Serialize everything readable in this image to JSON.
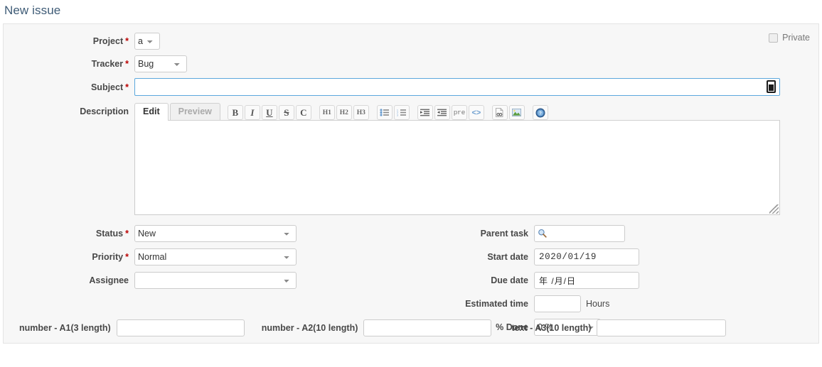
{
  "page": {
    "title": "New issue"
  },
  "privacy": {
    "checkbox_name": "private-checkbox",
    "label": "Private",
    "checked": false
  },
  "fields": {
    "project": {
      "label": "Project",
      "required": "*",
      "value": "a"
    },
    "tracker": {
      "label": "Tracker",
      "required": "*",
      "value": "Bug"
    },
    "subject": {
      "label": "Subject",
      "required": "*",
      "value": "",
      "placeholder": ""
    },
    "description": {
      "label": "Description",
      "value": "",
      "placeholder": ""
    },
    "status": {
      "label": "Status",
      "required": "*",
      "value": "New"
    },
    "priority": {
      "label": "Priority",
      "required": "*",
      "value": "Normal"
    },
    "assignee": {
      "label": "Assignee",
      "value": ""
    },
    "parent_task": {
      "label": "Parent task",
      "value": "",
      "icon": "magnifier-icon"
    },
    "start_date": {
      "label": "Start date",
      "value": "2020/01/19"
    },
    "due_date": {
      "label": "Due date",
      "value": "年 /月/日"
    },
    "estimated_time": {
      "label": "Estimated time",
      "value": "",
      "units": "Hours"
    },
    "done_ratio": {
      "label": "% Done",
      "value": "0 %"
    }
  },
  "editor": {
    "tabs": [
      {
        "label": "Edit",
        "active": true
      },
      {
        "label": "Preview",
        "active": false
      }
    ],
    "toolbar": [
      {
        "name": "bold-icon",
        "glyph": "B",
        "style": "serif"
      },
      {
        "name": "italic-icon",
        "glyph": "I",
        "style": "serif-italic"
      },
      {
        "name": "underline-icon",
        "glyph": "U",
        "style": "serif-underline"
      },
      {
        "name": "strikethrough-icon",
        "glyph": "S",
        "style": "serif-strike"
      },
      {
        "name": "code-inline-icon",
        "glyph": "C",
        "style": "serif"
      },
      {
        "name": "heading-1-icon",
        "glyph": "H1",
        "style": "heading"
      },
      {
        "name": "heading-2-icon",
        "glyph": "H2",
        "style": "heading"
      },
      {
        "name": "heading-3-icon",
        "glyph": "H3",
        "style": "heading"
      },
      {
        "name": "unordered-list-icon",
        "glyph": "",
        "style": "ul"
      },
      {
        "name": "ordered-list-icon",
        "glyph": "",
        "style": "ol"
      },
      {
        "name": "indent-icon",
        "glyph": "",
        "style": "indent"
      },
      {
        "name": "outdent-icon",
        "glyph": "",
        "style": "outdent"
      },
      {
        "name": "preformatted-icon",
        "glyph": "pre",
        "style": "pre"
      },
      {
        "name": "code-block-icon",
        "glyph": "<>",
        "style": "code"
      },
      {
        "name": "link-icon",
        "glyph": "",
        "style": "link"
      },
      {
        "name": "image-icon",
        "glyph": "",
        "style": "image"
      },
      {
        "name": "help-icon",
        "glyph": "?",
        "style": "help"
      }
    ]
  },
  "custom_fields": [
    {
      "label": "number - A1(3 length)",
      "value": ""
    },
    {
      "label": "number - A2(10 length)",
      "value": ""
    },
    {
      "label": "text - A3(10 length)",
      "value": ""
    }
  ],
  "colors": {
    "title": "#3e5b76",
    "panel_bg": "#f7f7f7",
    "panel_border": "#e4e4e4",
    "required_star": "#bb0000",
    "focus_border": "#5ca8dd",
    "label_text": "#484848"
  }
}
